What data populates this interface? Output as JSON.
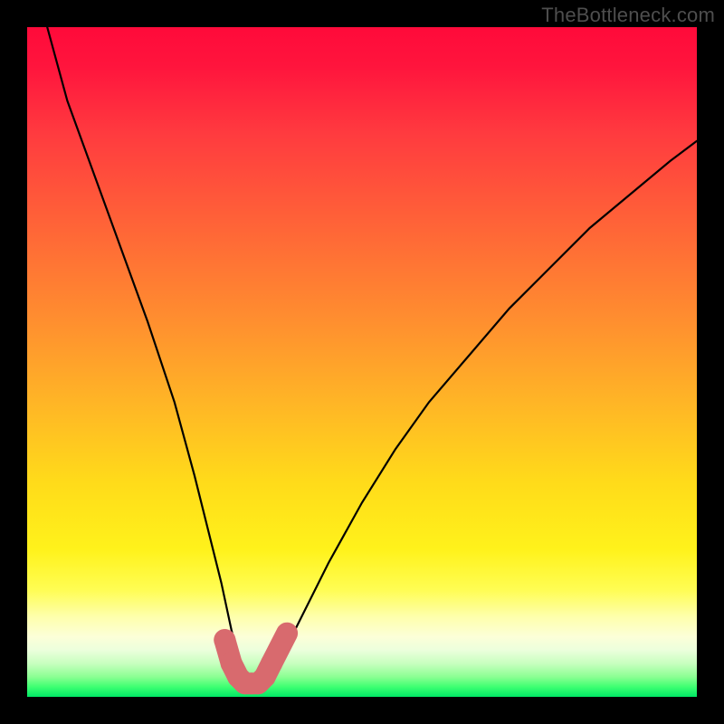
{
  "watermark": "TheBottleneck.com",
  "chart_data": {
    "type": "line",
    "title": "",
    "xlabel": "",
    "ylabel": "",
    "xlim": [
      0,
      100
    ],
    "ylim": [
      0,
      100
    ],
    "grid": false,
    "series": [
      {
        "name": "bottleneck-curve",
        "color": "#000000",
        "x": [
          3,
          6,
          10,
          14,
          18,
          22,
          25,
          27,
          29,
          30.5,
          32,
          33.5,
          35,
          37,
          40,
          45,
          50,
          55,
          60,
          66,
          72,
          78,
          84,
          90,
          96,
          100
        ],
        "values": [
          100,
          89,
          78,
          67,
          56,
          44,
          33,
          25,
          17,
          10,
          4,
          1.5,
          1.5,
          4,
          10,
          20,
          29,
          37,
          44,
          51,
          58,
          64,
          70,
          75,
          80,
          83
        ]
      }
    ],
    "markers": {
      "name": "highlight-segment",
      "color": "#d86a6e",
      "x": [
        29.5,
        30.5,
        31.5,
        32.5,
        33.5,
        34.5,
        35.5,
        36.5,
        38.8
      ],
      "values": [
        8.5,
        5.0,
        3.0,
        2.0,
        2.0,
        2.0,
        3.0,
        5.0,
        9.5
      ],
      "radius": 12,
      "outlier_radius": 8
    }
  }
}
